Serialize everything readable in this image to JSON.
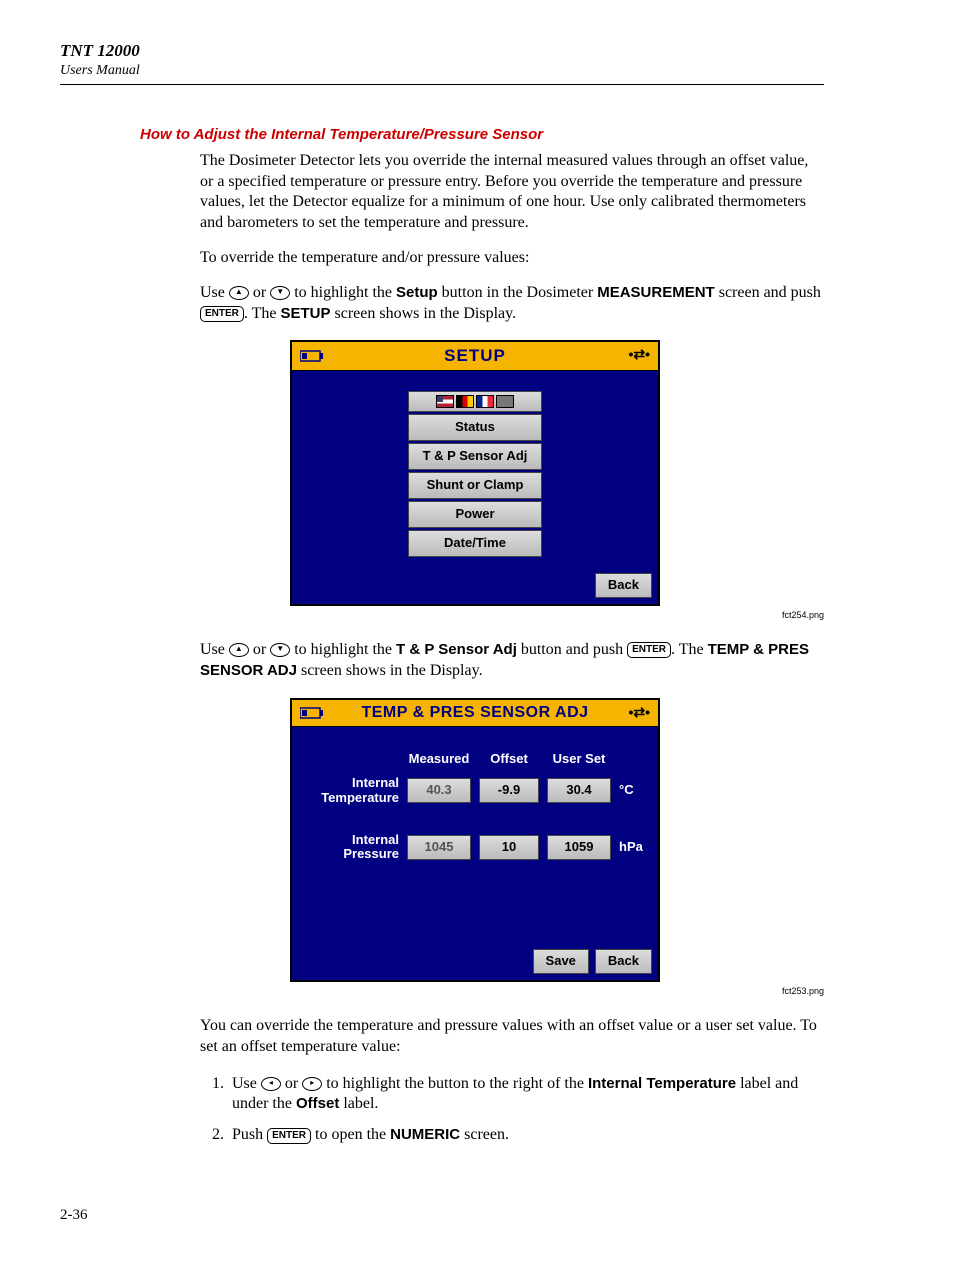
{
  "header": {
    "product": "TNT 12000",
    "subtitle": "Users Manual"
  },
  "section_title": "How to Adjust the Internal Temperature/Pressure Sensor",
  "p1": "The Dosimeter Detector lets you override the internal measured values through an offset value, or a specified temperature or pressure entry. Before you override the temperature and pressure values, let the Detector equalize for a minimum of one hour. Use only calibrated thermometers and barometers to set the temperature and pressure.",
  "p2": "To override the temperature and/or pressure values:",
  "p3a": "Use ",
  "p3b": " or ",
  "p3c": " to highlight the ",
  "p3_setup": "Setup",
  "p3d": " button in the Dosimeter ",
  "p3_meas": "MEASUREMENT",
  "p3e": " screen and push ",
  "enter": "ENTER",
  "p3f": ". The ",
  "p3_SETUP": "SETUP",
  "p3g": " screen shows in the Display.",
  "screen1": {
    "title": "SETUP",
    "menu": [
      "Status",
      "T & P Sensor Adj",
      "Shunt or Clamp",
      "Power",
      "Date/Time"
    ],
    "back": "Back"
  },
  "cap1": "fct254.png",
  "p4a": "Use ",
  "p4b": " or ",
  "p4c": " to highlight the ",
  "p4_btn": "T & P Sensor Adj",
  "p4d": " button and push ",
  "p4e": ". The ",
  "p4_temp": "TEMP & PRES SENSOR ADJ",
  "p4f": " screen shows in the Display.",
  "screen2": {
    "title": "TEMP & PRES SENSOR ADJ",
    "cols": [
      "Measured",
      "Offset",
      "User Set"
    ],
    "rows": [
      {
        "label": "Internal Temperature",
        "measured": "40.3",
        "offset": "-9.9",
        "user": "30.4",
        "unit": "°C"
      },
      {
        "label": "Internal Pressure",
        "measured": "1045",
        "offset": "10",
        "user": "1059",
        "unit": "hPa"
      }
    ],
    "save": "Save",
    "back": "Back"
  },
  "cap2": "fct253.png",
  "p5": "You can override the temperature and pressure values with an offset value or a user set value. To set an offset temperature value:",
  "li1a": "Use ",
  "li1b": " or ",
  "li1c": " to highlight the button to the right of the ",
  "li1_it": "Internal Temperature",
  "li1d": " label and under the ",
  "li1_off": "Offset",
  "li1e": " label.",
  "li2a": "Push ",
  "li2b": " to open the ",
  "li2_num": "NUMERIC",
  "li2c": " screen.",
  "page_num": "2-36",
  "arrows": {
    "up": "▲",
    "down": "▼",
    "left": "◂",
    "right": "▸"
  }
}
